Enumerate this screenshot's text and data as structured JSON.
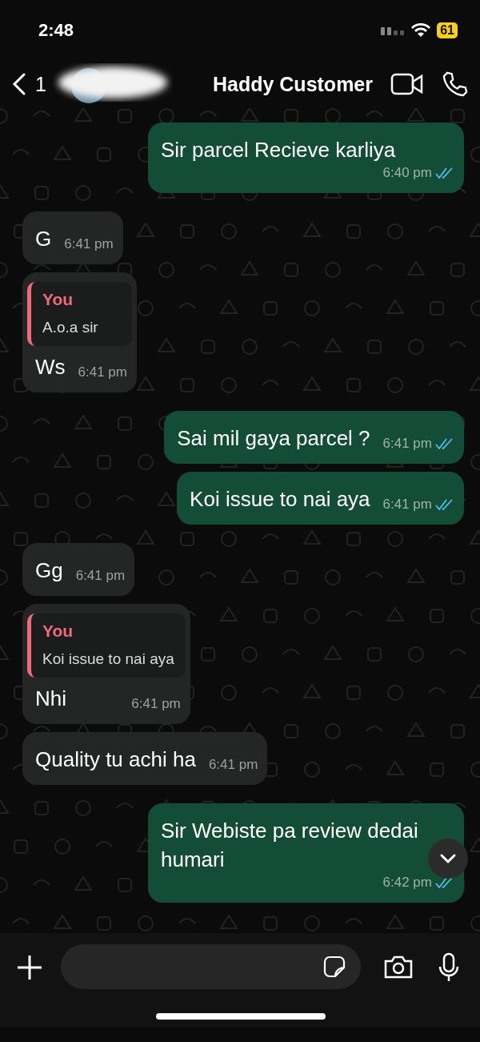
{
  "status_bar": {
    "time": "2:48",
    "battery": "61"
  },
  "header": {
    "unread_count": "1",
    "name": "Haddy Customer"
  },
  "messages": [
    {
      "kind": "outgoing",
      "text": "Sir parcel Recieve karliya",
      "time": "6:40 pm",
      "read": true
    },
    {
      "kind": "incoming",
      "text": "G",
      "time": "6:41 pm"
    },
    {
      "kind": "incoming",
      "quote": {
        "author": "You",
        "text": "A.o.a sir"
      },
      "text": "Ws",
      "time": "6:41 pm"
    },
    {
      "kind": "outgoing",
      "text": "Sai mil gaya parcel ?",
      "time": "6:41 pm",
      "read": true
    },
    {
      "kind": "outgoing",
      "text": "Koi issue to nai aya",
      "time": "6:41 pm",
      "read": true
    },
    {
      "kind": "incoming",
      "text": "Gg",
      "time": "6:41 pm"
    },
    {
      "kind": "incoming",
      "quote": {
        "author": "You",
        "text": "Koi issue to nai aya"
      },
      "text": "Nhi",
      "time": "6:41 pm"
    },
    {
      "kind": "incoming",
      "text": "Quality tu achi ha",
      "time": "6:41 pm"
    },
    {
      "kind": "outgoing",
      "text": "Sir Webiste pa review dedai\nhumari",
      "time": "6:42 pm",
      "read": true
    }
  ]
}
